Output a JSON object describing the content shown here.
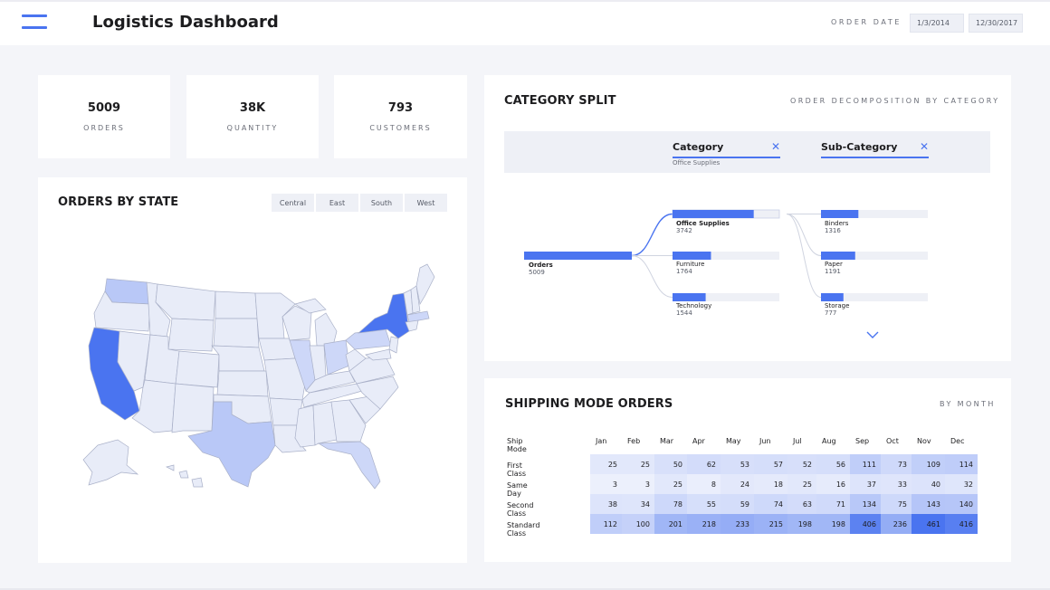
{
  "header": {
    "title": "Logistics Dashboard",
    "date_label": "ORDER DATE",
    "date_start": "1/3/2014",
    "date_end": "12/30/2017"
  },
  "kpis": [
    {
      "value": "5009",
      "label": "ORDERS"
    },
    {
      "value": "38K",
      "label": "QUANTITY"
    },
    {
      "value": "793",
      "label": "CUSTOMERS"
    }
  ],
  "map_card": {
    "title": "ORDERS BY STATE",
    "regions": [
      "Central",
      "East",
      "South",
      "West"
    ],
    "highlight_colors": {
      "high": "#4a74f0",
      "mid": "#b9c8f7",
      "low": "#e8ecf8"
    }
  },
  "category_card": {
    "title": "CATEGORY SPLIT",
    "subtitle": "ORDER DECOMPOSITION BY CATEGORY",
    "filters": [
      {
        "label": "Category",
        "value": "Office Supplies"
      },
      {
        "label": "Sub-Category",
        "value": ""
      }
    ],
    "root": {
      "label": "Orders",
      "value": "5009"
    },
    "categories": [
      {
        "label": "Office Supplies",
        "value": "3742",
        "fraction": 0.76
      },
      {
        "label": "Furniture",
        "value": "1764",
        "fraction": 0.36
      },
      {
        "label": "Technology",
        "value": "1544",
        "fraction": 0.31
      }
    ],
    "subcategories": [
      {
        "label": "Binders",
        "value": "1316",
        "fraction": 0.35
      },
      {
        "label": "Paper",
        "value": "1191",
        "fraction": 0.32
      },
      {
        "label": "Storage",
        "value": "777",
        "fraction": 0.21
      }
    ],
    "accent": "#4a74f0"
  },
  "shipping_card": {
    "title": "SHIPPING MODE ORDERS",
    "subtitle": "BY MONTH",
    "corner_label": "Ship Mode",
    "months": [
      "Jan",
      "Feb",
      "Mar",
      "Apr",
      "May",
      "Jun",
      "Jul",
      "Aug",
      "Sep",
      "Oct",
      "Nov",
      "Dec"
    ],
    "rows": [
      {
        "mode": "First Class",
        "values": [
          25,
          25,
          50,
          62,
          53,
          57,
          52,
          56,
          111,
          73,
          109,
          114
        ]
      },
      {
        "mode": "Same Day",
        "values": [
          3,
          3,
          25,
          8,
          24,
          18,
          25,
          16,
          37,
          33,
          40,
          32
        ]
      },
      {
        "mode": "Second Class",
        "values": [
          38,
          34,
          78,
          55,
          59,
          74,
          63,
          71,
          134,
          75,
          143,
          140
        ]
      },
      {
        "mode": "Standard Class",
        "values": [
          112,
          100,
          201,
          218,
          233,
          215,
          198,
          198,
          406,
          236,
          461,
          416
        ]
      }
    ]
  }
}
